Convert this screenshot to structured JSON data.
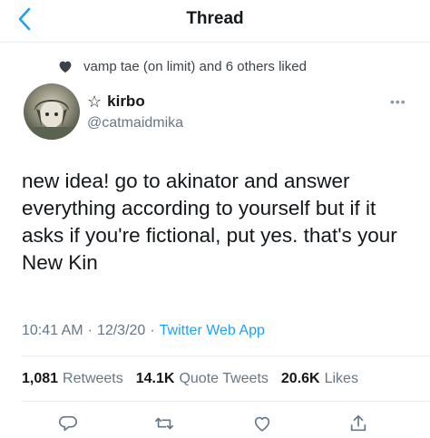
{
  "header": {
    "title": "Thread",
    "back_icon": "chevron-left-icon"
  },
  "social_context": {
    "icon": "heart-icon",
    "text": "vamp tae (on limit) and 6 others liked"
  },
  "author": {
    "star_icon": "star-outline-icon",
    "display_name": "kirbo",
    "handle": "@catmaidmika"
  },
  "more_icon": "more-dots-icon",
  "tweet": {
    "text": "new idea! go to akinator and answer everything according to yourself but if it asks if you're fictional, put yes. that's your New Kin"
  },
  "meta": {
    "time": "10:41 AM",
    "sep1": "·",
    "date": "12/3/20",
    "sep2": "·",
    "source": "Twitter Web App"
  },
  "stats": {
    "retweets_count": "1,081",
    "retweets_label": "Retweets",
    "quotes_count": "14.1K",
    "quotes_label": "Quote Tweets",
    "likes_count": "20.6K",
    "likes_label": "Likes"
  },
  "actions": [
    "reply-icon",
    "retweet-icon",
    "like-icon",
    "share-icon"
  ],
  "colors": {
    "accent": "#1da1f2",
    "secondary_text": "#657786",
    "primary_text": "#14171a"
  }
}
